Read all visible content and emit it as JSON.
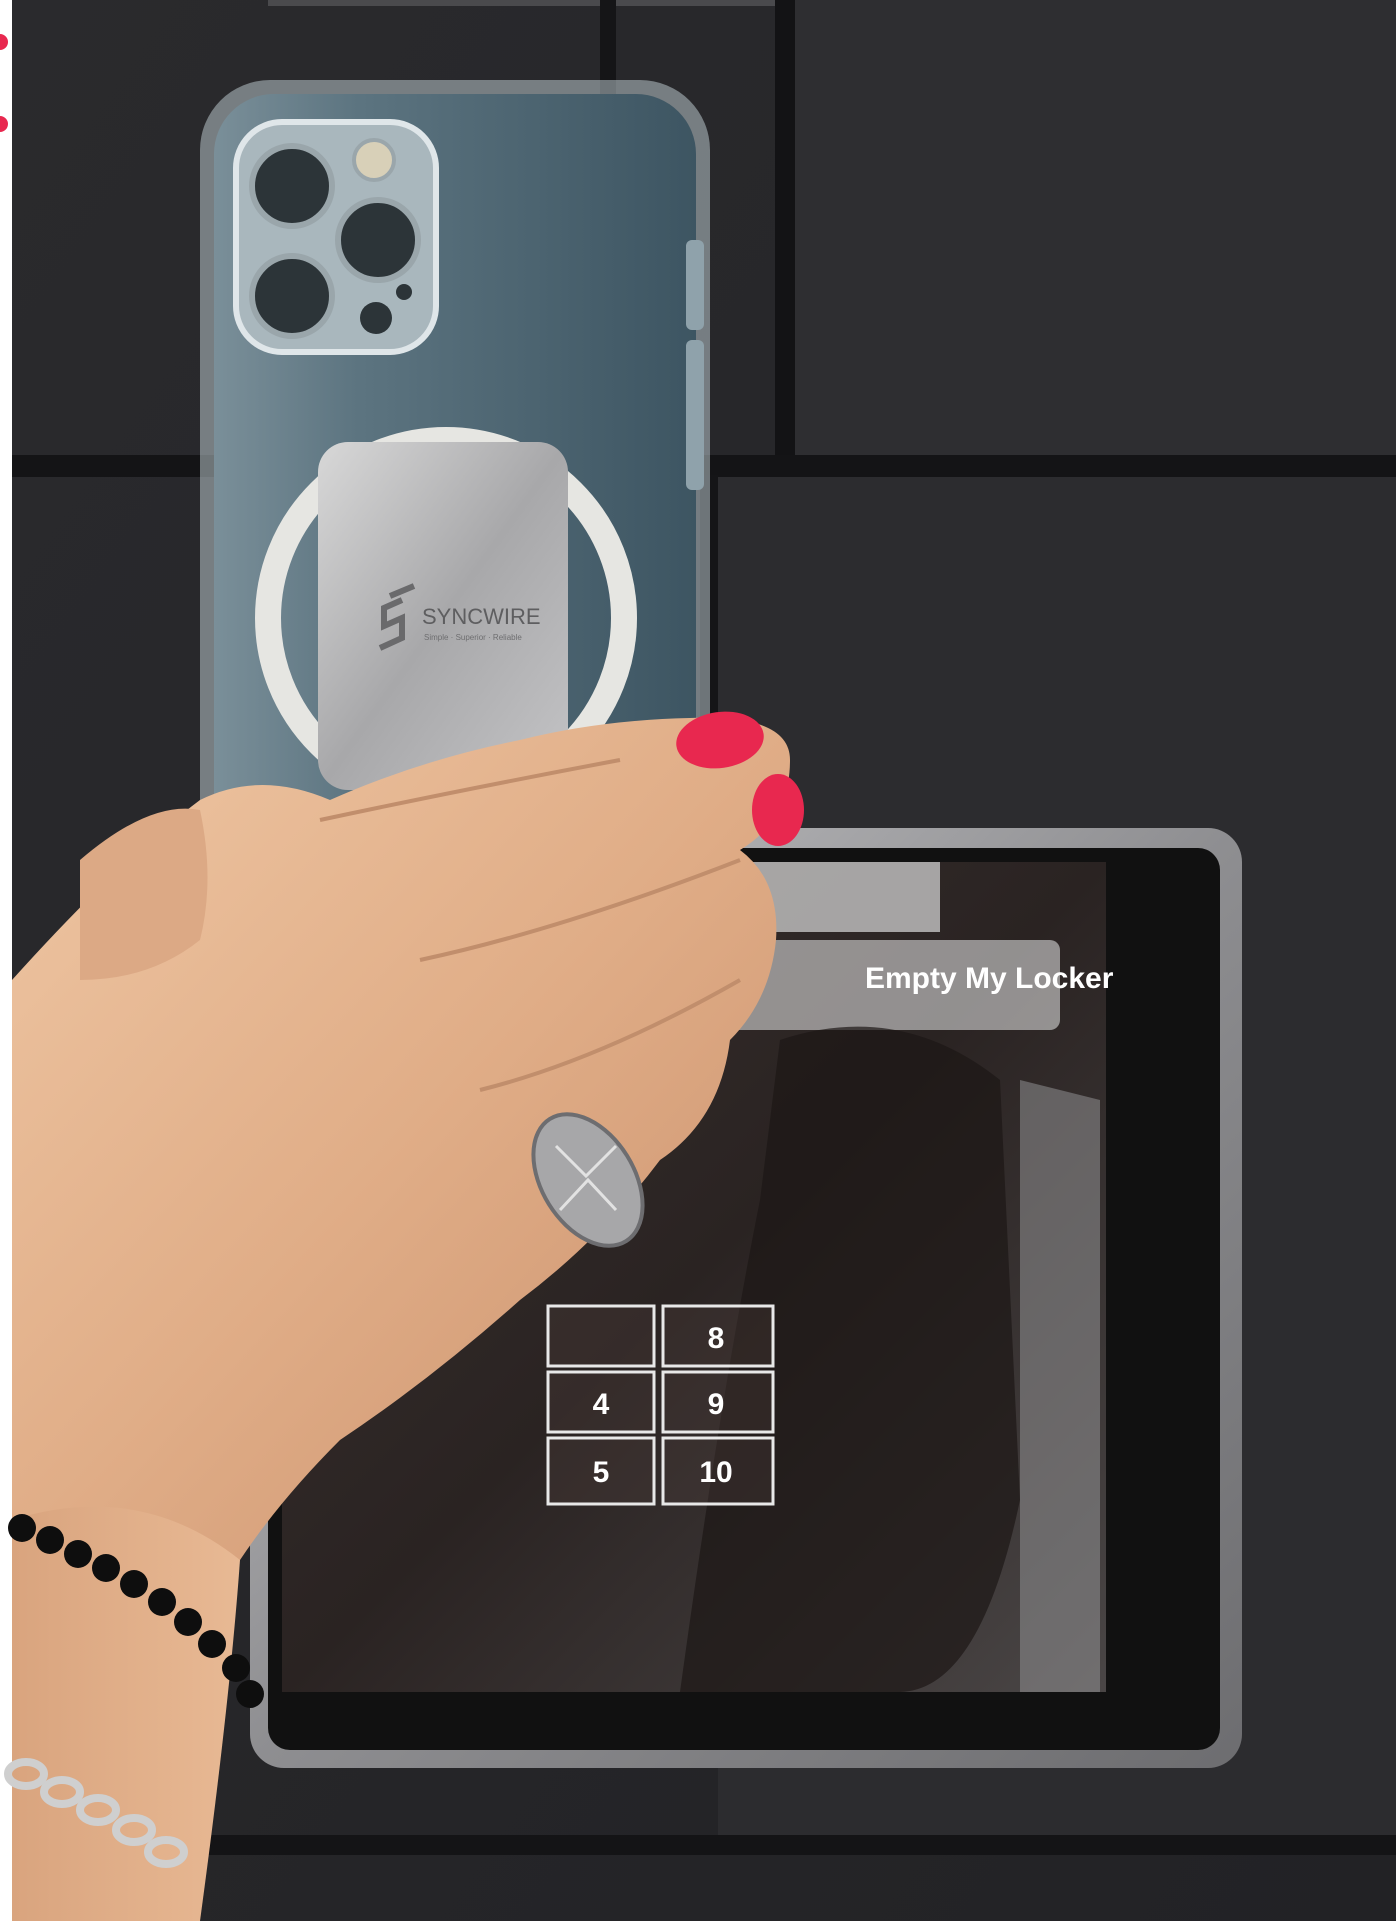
{
  "photo": {
    "locker_screen": {
      "button_label": "Empty My Locker",
      "keypad": [
        {
          "row": 1,
          "left": "",
          "right": "8"
        },
        {
          "row": 2,
          "left": "4",
          "right": "9"
        },
        {
          "row": 3,
          "left": "5",
          "right": "10"
        }
      ]
    },
    "phone_case": {
      "brand": "SYNCWIRE",
      "tagline": "Simple · Superior · Reliable"
    }
  },
  "colors": {
    "wall": "#2b2b2e",
    "panel_seam": "#121214",
    "screen_frame": "#9a9a9c",
    "nail_polish": "#e8284f",
    "skin": "#e3b48f",
    "phone_blue": "#5c7480"
  }
}
